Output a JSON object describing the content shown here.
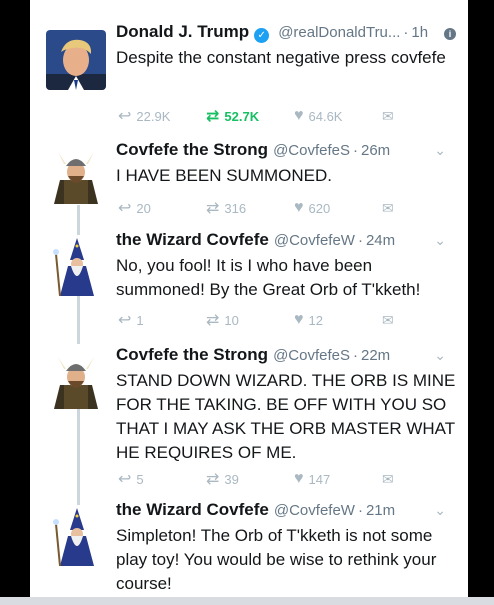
{
  "tweets": [
    {
      "name": "Donald J. Trump",
      "handle": "@realDonaldTru...",
      "time": "1h",
      "verified": true,
      "text": "Despite the constant negative press covfefe",
      "reply_count": "22.9K",
      "retweet_count": "52.7K",
      "like_count": "64.6K"
    },
    {
      "name": "Covfefe the Strong",
      "handle": "@CovfefeS",
      "time": "26m",
      "text": "I HAVE BEEN SUMMONED.",
      "reply_count": "20",
      "retweet_count": "316",
      "like_count": "620"
    },
    {
      "name": "the Wizard Covfefe",
      "handle": "@CovfefeW",
      "time": "24m",
      "text": "No, you fool! It is I who have been summoned! By the Great Orb of T'kketh!",
      "reply_count": "1",
      "retweet_count": "10",
      "like_count": "12"
    },
    {
      "name": "Covfefe the Strong",
      "handle": "@CovfefeS",
      "time": "22m",
      "text": "STAND DOWN WIZARD. THE ORB IS MINE FOR THE TAKING. BE OFF WITH YOU SO THAT I MAY ASK THE ORB MASTER WHAT HE REQUIRES OF ME.",
      "reply_count": "5",
      "retweet_count": "39",
      "like_count": "147"
    },
    {
      "name": "the Wizard Covfefe",
      "handle": "@CovfefeW",
      "time": "21m",
      "text": "Simpleton! The Orb of T'kketh is not some play toy! You would be wise to rethink your course!"
    }
  ],
  "icons": {
    "reply": "reply-icon",
    "retweet": "retweet-icon",
    "like": "heart-icon",
    "dm": "envelope-icon",
    "more": "chevron-down-icon",
    "info": "info-icon"
  },
  "colors": {
    "retweet_active": "#17bf63",
    "verified": "#1da1f2",
    "muted": "#657786",
    "action_gray": "#aab8c2",
    "thread_line": "#ccd6dd"
  }
}
